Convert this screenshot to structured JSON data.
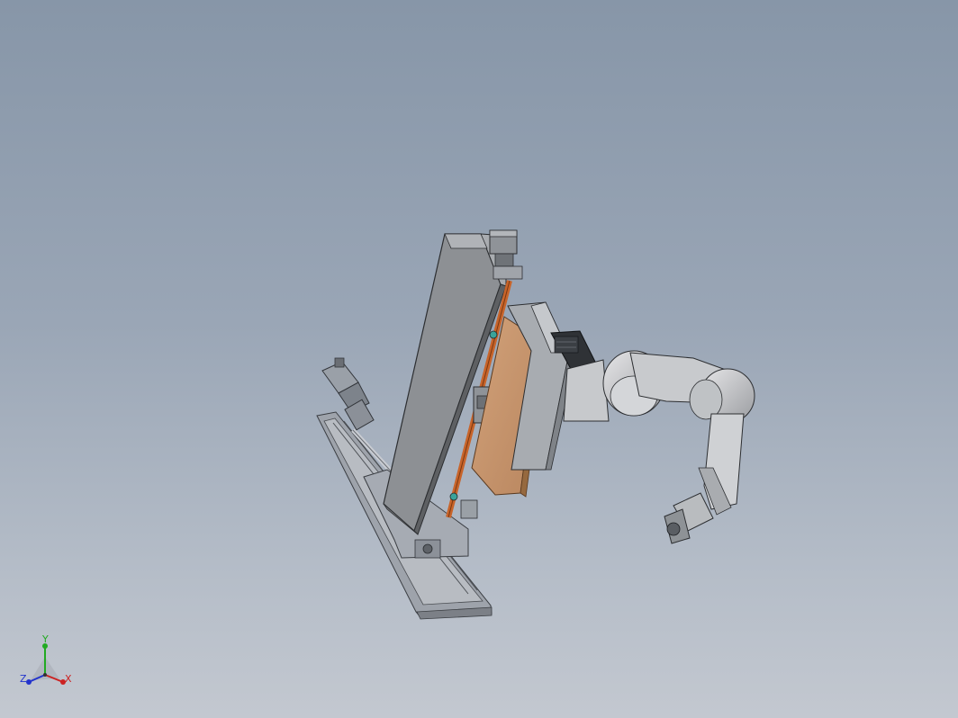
{
  "viewport": {
    "background_top": "#8796a8",
    "background_bottom": "#c3c8d0"
  },
  "model": {
    "parts": [
      "linear-slide-base",
      "ball-screw",
      "servo-motor",
      "vertical-column",
      "stepper-motor",
      "orange-linear-rail",
      "wooden-plate",
      "gray-mounting-block",
      "robot-arm",
      "end-effector"
    ]
  },
  "triad": {
    "x_label": "X",
    "y_label": "Y",
    "z_label": "Z",
    "x_color": "#cc2222",
    "y_color": "#22aa22",
    "z_color": "#2233cc"
  }
}
